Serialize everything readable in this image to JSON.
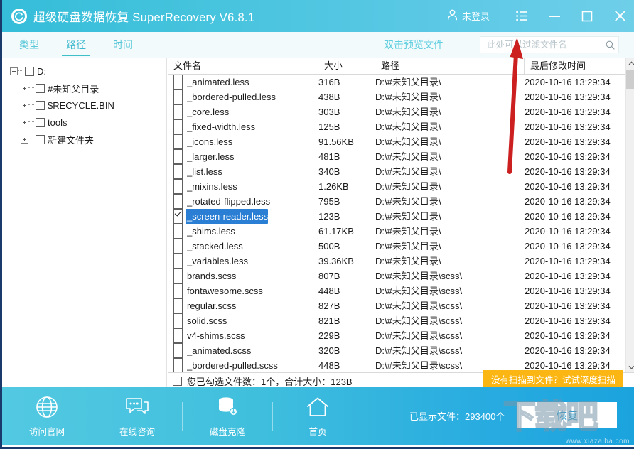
{
  "titlebar": {
    "app_title": "超级硬盘数据恢复 SuperRecovery V6.8.1",
    "logo_icon": "recovery-circle-icon",
    "user_label": "未登录",
    "user_icon": "user-icon",
    "menu_icon": "list-menu-icon",
    "minimize_icon": "minimize-icon",
    "maximize_icon": "maximize-icon",
    "close_icon": "close-icon",
    "bg_color": "#45c3dd"
  },
  "tabs": [
    {
      "label": "类型",
      "active": false
    },
    {
      "label": "路径",
      "active": true
    },
    {
      "label": "时间",
      "active": false
    }
  ],
  "toolbar": {
    "preview_hint": "双击预览文件",
    "search_placeholder": "此处可以过滤文件名",
    "search_value": "",
    "search_icon": "search-icon",
    "accent_color": "#3fc0c9"
  },
  "tree": {
    "items": [
      {
        "label": "D:",
        "indent": 0,
        "expander": "minus",
        "checked": false
      },
      {
        "label": "#未知父目录",
        "indent": 1,
        "expander": "plus",
        "checked": false
      },
      {
        "label": "$RECYCLE.BIN",
        "indent": 1,
        "expander": "plus",
        "checked": false
      },
      {
        "label": "tools",
        "indent": 1,
        "expander": "plus",
        "checked": false
      },
      {
        "label": "新建文件夹",
        "indent": 1,
        "expander": "plus",
        "checked": false
      }
    ]
  },
  "filelist": {
    "columns": [
      "文件名",
      "大小",
      "路径",
      "最后修改时间"
    ],
    "rows": [
      {
        "name": "_animated.less",
        "size": "316B",
        "path": "D:\\#未知父目录\\",
        "time": "2020-10-16 13:29:34",
        "checked": false,
        "selected": false
      },
      {
        "name": "_bordered-pulled.less",
        "size": "438B",
        "path": "D:\\#未知父目录\\",
        "time": "2020-10-16 13:29:34",
        "checked": false,
        "selected": false
      },
      {
        "name": "_core.less",
        "size": "303B",
        "path": "D:\\#未知父目录\\",
        "time": "2020-10-16 13:29:34",
        "checked": false,
        "selected": false
      },
      {
        "name": "_fixed-width.less",
        "size": "125B",
        "path": "D:\\#未知父目录\\",
        "time": "2020-10-16 13:29:34",
        "checked": false,
        "selected": false
      },
      {
        "name": "_icons.less",
        "size": "91.56KB",
        "path": "D:\\#未知父目录\\",
        "time": "2020-10-16 13:29:34",
        "checked": false,
        "selected": false
      },
      {
        "name": "_larger.less",
        "size": "481B",
        "path": "D:\\#未知父目录\\",
        "time": "2020-10-16 13:29:34",
        "checked": false,
        "selected": false
      },
      {
        "name": "_list.less",
        "size": "340B",
        "path": "D:\\#未知父目录\\",
        "time": "2020-10-16 13:29:34",
        "checked": false,
        "selected": false
      },
      {
        "name": "_mixins.less",
        "size": "1.26KB",
        "path": "D:\\#未知父目录\\",
        "time": "2020-10-16 13:29:34",
        "checked": false,
        "selected": false
      },
      {
        "name": "_rotated-flipped.less",
        "size": "795B",
        "path": "D:\\#未知父目录\\",
        "time": "2020-10-16 13:29:34",
        "checked": false,
        "selected": false
      },
      {
        "name": "_screen-reader.less",
        "size": "123B",
        "path": "D:\\#未知父目录\\",
        "time": "2020-10-16 13:29:34",
        "checked": true,
        "selected": true
      },
      {
        "name": "_shims.less",
        "size": "61.17KB",
        "path": "D:\\#未知父目录\\",
        "time": "2020-10-16 13:29:34",
        "checked": false,
        "selected": false
      },
      {
        "name": "_stacked.less",
        "size": "500B",
        "path": "D:\\#未知父目录\\",
        "time": "2020-10-16 13:29:34",
        "checked": false,
        "selected": false
      },
      {
        "name": "_variables.less",
        "size": "39.36KB",
        "path": "D:\\#未知父目录\\",
        "time": "2020-10-16 13:29:34",
        "checked": false,
        "selected": false
      },
      {
        "name": "brands.scss",
        "size": "807B",
        "path": "D:\\#未知父目录\\scss\\",
        "time": "2020-10-16 13:29:34",
        "checked": false,
        "selected": false
      },
      {
        "name": "fontawesome.scss",
        "size": "448B",
        "path": "D:\\#未知父目录\\scss\\",
        "time": "2020-10-16 13:29:34",
        "checked": false,
        "selected": false
      },
      {
        "name": "regular.scss",
        "size": "827B",
        "path": "D:\\#未知父目录\\scss\\",
        "time": "2020-10-16 13:29:34",
        "checked": false,
        "selected": false
      },
      {
        "name": "solid.scss",
        "size": "821B",
        "path": "D:\\#未知父目录\\scss\\",
        "time": "2020-10-16 13:29:34",
        "checked": false,
        "selected": false
      },
      {
        "name": "v4-shims.scss",
        "size": "229B",
        "path": "D:\\#未知父目录\\scss\\",
        "time": "2020-10-16 13:29:34",
        "checked": false,
        "selected": false
      },
      {
        "name": "_animated.scss",
        "size": "320B",
        "path": "D:\\#未知父目录\\scss\\",
        "time": "2020-10-16 13:29:34",
        "checked": false,
        "selected": false
      },
      {
        "name": "_bordered-pulled.scss",
        "size": "448B",
        "path": "D:\\#未知父目录\\scss\\",
        "time": "2020-10-16 13:29:34",
        "checked": false,
        "selected": false
      }
    ],
    "scroll_up_icon": "chevron-up-icon",
    "scroll_down_icon": "chevron-down-icon"
  },
  "status": {
    "select_all_checked": false,
    "summary": "您已勾选文件数：1个，合计大小：123B",
    "deep_scan_label": "没有扫描到文件？试试深度扫描",
    "deep_scan_color": "#fbb613"
  },
  "bottombar": {
    "items": [
      {
        "label": "访问官网",
        "icon": "globe-icon"
      },
      {
        "label": "在线咨询",
        "icon": "chat-icon"
      },
      {
        "label": "磁盘克隆",
        "icon": "database-clone-icon"
      },
      {
        "label": "首页",
        "icon": "home-icon"
      }
    ],
    "shown_count": "已显示文件：293400个",
    "recover_label": "恢复"
  },
  "overlay": {
    "arrow_icon": "red-up-arrow-annotation",
    "arrow_color": "#cc1f1f",
    "watermark_text": "下载吧",
    "watermark_url": "www.xiazaiba.com"
  }
}
